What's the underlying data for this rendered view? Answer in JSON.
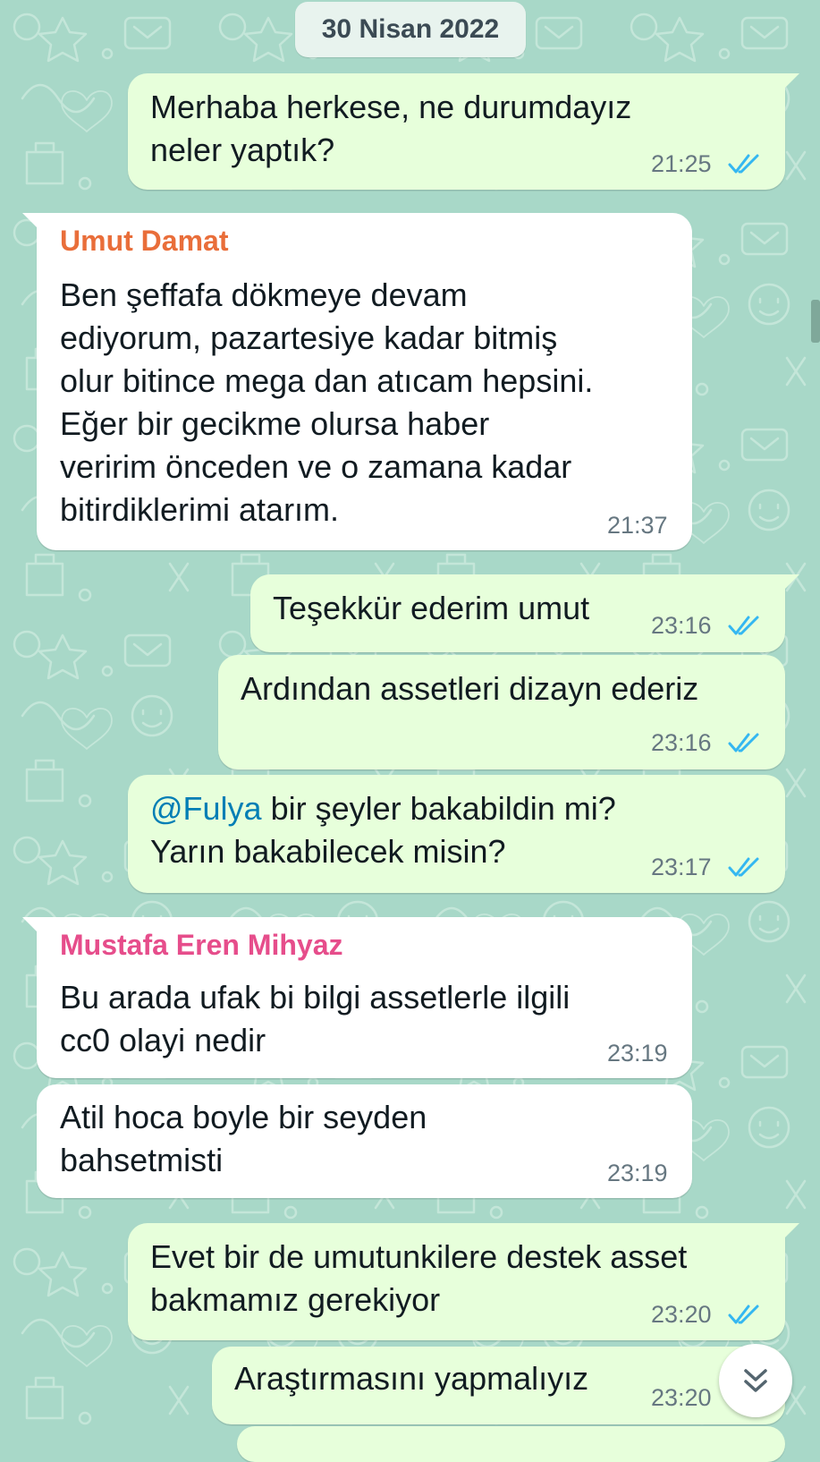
{
  "date_separator": "30 Nisan 2022",
  "colors": {
    "outgoing_bubble": "#e7ffdb",
    "incoming_bubble": "#ffffff",
    "read_ticks": "#34b7f1",
    "sender_umut": "#e96e3a",
    "sender_mustafa": "#e64d8b",
    "mention": "#027eb5",
    "wallpaper": "#a8d8c8"
  },
  "messages": [
    {
      "lines": [
        "Merhaba herkese, ne durumdayız",
        "neler yaptık?"
      ],
      "time": "21:25",
      "status": "read"
    },
    {
      "sender": "Umut Damat",
      "lines": [
        "Ben şeffafa dökmeye devam",
        "ediyorum, pazartesiye kadar bitmiş",
        "olur bitince mega dan atıcam hepsini.",
        "Eğer bir gecikme olursa haber",
        "veririm önceden ve o zamana kadar",
        "bitirdiklerimi atarım."
      ],
      "time": "21:37"
    },
    {
      "lines": [
        "Teşekkür ederim umut"
      ],
      "time": "23:16",
      "status": "read"
    },
    {
      "lines": [
        "Ardından assetleri dizayn ederiz"
      ],
      "time": "23:16",
      "status": "read"
    },
    {
      "mention": "@Fulya",
      "lines": [
        " bir şeyler bakabildin mi?",
        "Yarın bakabilecek misin?"
      ],
      "time": "23:17",
      "status": "read"
    },
    {
      "sender": "Mustafa Eren Mihyaz",
      "lines": [
        "Bu arada ufak bi bilgi assetlerle ilgili",
        "cc0 olayi nedir"
      ],
      "time": "23:19"
    },
    {
      "lines": [
        "Atil hoca boyle bir seyden",
        "bahsetmisti"
      ],
      "time": "23:19"
    },
    {
      "lines": [
        "Evet bir de umutunkilere destek asset",
        "bakmamız gerekiyor"
      ],
      "time": "23:20",
      "status": "read"
    },
    {
      "lines": [
        "Araştırmasını yapmalıyız"
      ],
      "time": "23:20",
      "status": "read"
    }
  ],
  "icons": {
    "read_receipt": "double-check-icon",
    "scroll_down": "double-chevron-down-icon"
  }
}
